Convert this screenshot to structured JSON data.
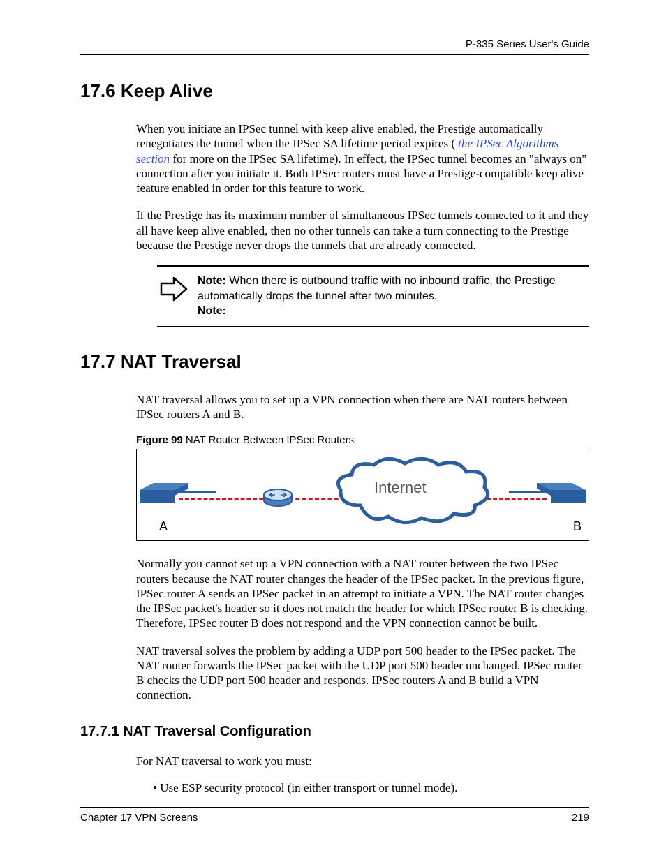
{
  "header": {
    "guide_title": "P-335 Series User's Guide"
  },
  "sections": {
    "s176": {
      "heading": "17.6  Keep Alive",
      "p1_a": "When you initiate an IPSec tunnel with keep alive enabled, the Prestige automatically renegotiates the tunnel when the IPSec SA lifetime period expires ( ",
      "p1_link": "the IPSec Algorithms section",
      "p1_b": "  for more on the IPSec SA lifetime). In effect, the IPSec tunnel becomes an \"always on\" connection after you initiate it. Both IPSec routers must have a Prestige-compatible keep alive feature enabled in order for this feature to work.",
      "p2": "If the Prestige has its maximum number of simultaneous IPSec tunnels connected to it and they all have keep alive enabled, then no other tunnels can take a turn connecting to the Prestige because the Prestige never drops the tunnels that are already connected.",
      "note_label": "Note:",
      "note_body": " When there is outbound traffic with no inbound traffic, the Prestige automatically drops the tunnel after two minutes.",
      "note_trailing": "Note:"
    },
    "s177": {
      "heading": "17.7  NAT Traversal",
      "p1": "NAT traversal allows you to set up a VPN connection when there are NAT routers between IPSec routers A and B.",
      "fig_label": "Figure 99",
      "fig_title": "   NAT Router Between IPSec Routers",
      "fig_cloud": "Internet",
      "fig_a": "A",
      "fig_b": "B",
      "p2": "Normally you cannot set up a VPN connection with a NAT router between the two IPSec routers because the NAT router changes the header of the IPSec packet. In the previous figure, IPSec router A sends an IPSec packet in an attempt to initiate a VPN. The NAT router changes the IPSec packet's header so it does not match the header for which IPSec router B is checking. Therefore, IPSec router B does not respond and the VPN connection cannot be built.",
      "p3": "NAT traversal solves the problem by adding a UDP port 500 header to the IPSec packet. The NAT router forwards the IPSec packet with the UDP port 500 header unchanged. IPSec router B checks the UDP port 500 header and responds. IPSec routers A and B build a VPN connection."
    },
    "s1771": {
      "heading": "17.7.1  NAT Traversal Configuration",
      "p1": "For NAT traversal to work you must:",
      "bullet1": "Use ESP security protocol (in either transport or tunnel mode)."
    }
  },
  "footer": {
    "chapter": "Chapter 17 VPN Screens",
    "page": "219"
  }
}
